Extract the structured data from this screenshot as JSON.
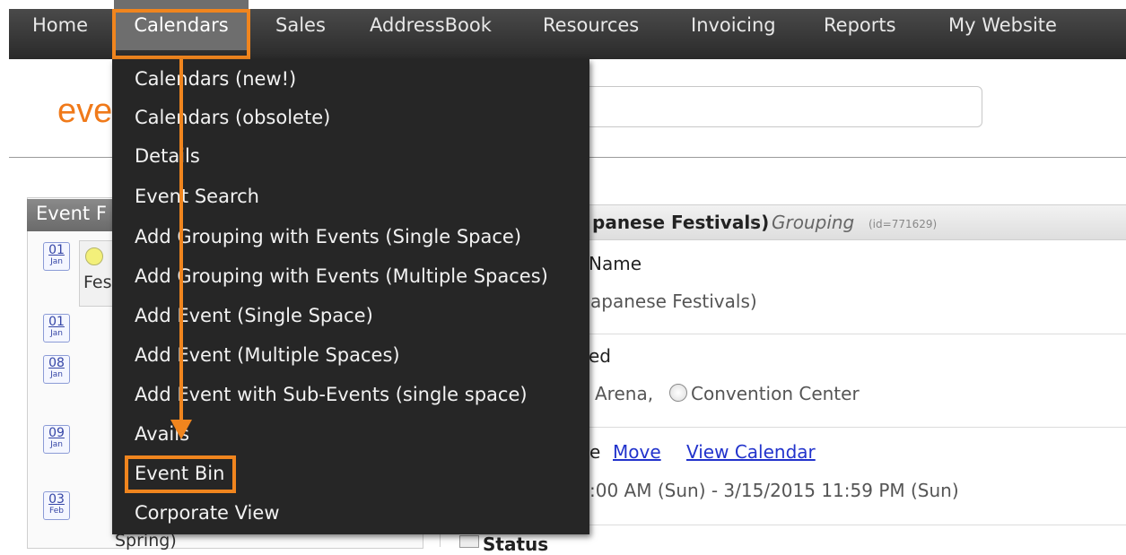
{
  "nav": {
    "items": [
      {
        "label": "Home"
      },
      {
        "label": "Calendars"
      },
      {
        "label": "Sales"
      },
      {
        "label": "AddressBook"
      },
      {
        "label": "Resources"
      },
      {
        "label": "Invoicing"
      },
      {
        "label": "Reports"
      },
      {
        "label": "My Website"
      }
    ],
    "active": "Calendars"
  },
  "logo_text": "eve",
  "left_panel": {
    "title": "Event F",
    "entries": [
      {
        "day": "01",
        "month": "Jan"
      },
      {
        "day": "01",
        "month": "Jan"
      },
      {
        "day": "08",
        "month": "Jan"
      },
      {
        "day": "09",
        "month": "Jan"
      },
      {
        "day": "03",
        "month": "Feb"
      }
    ],
    "fragments": [
      "Fes",
      "Spring)"
    ]
  },
  "right_panel": {
    "header_title": "panese Festivals)",
    "header_sep": " : ",
    "header_type": "Grouping",
    "header_id": "(id=771629)",
    "name_label": "Name",
    "name_value": "apanese Festivals)",
    "spaces_label": "ed",
    "space_1": "Arena,",
    "space_2": "Convention Center",
    "date_label": "e",
    "move_link": "Move",
    "view_calendar_link": "View Calendar",
    "date_range": ":00 AM (Sun) - 3/15/2015 11:59 PM (Sun)",
    "status_label": "Status"
  },
  "dropdown": {
    "items": [
      {
        "label": "Calendars (new!)"
      },
      {
        "label": "Calendars (obsolete)"
      },
      {
        "label": "Details"
      },
      {
        "label": "Event Search"
      },
      {
        "label": "Add Grouping with Events (Single Space)"
      },
      {
        "label": "Add Grouping with Events (Multiple Spaces)"
      },
      {
        "label": "Add Event (Single Space)"
      },
      {
        "label": "Add Event (Multiple Spaces)"
      },
      {
        "label": "Add Event with Sub-Events (single space)"
      },
      {
        "label": "Avails"
      },
      {
        "label": "Event Bin"
      },
      {
        "label": "Corporate View"
      }
    ]
  },
  "colors": {
    "accent": "#f0851e",
    "nav_bg": "#333333",
    "menu_bg": "#262626",
    "logo": "#f07a1a",
    "link": "#2233cc"
  }
}
